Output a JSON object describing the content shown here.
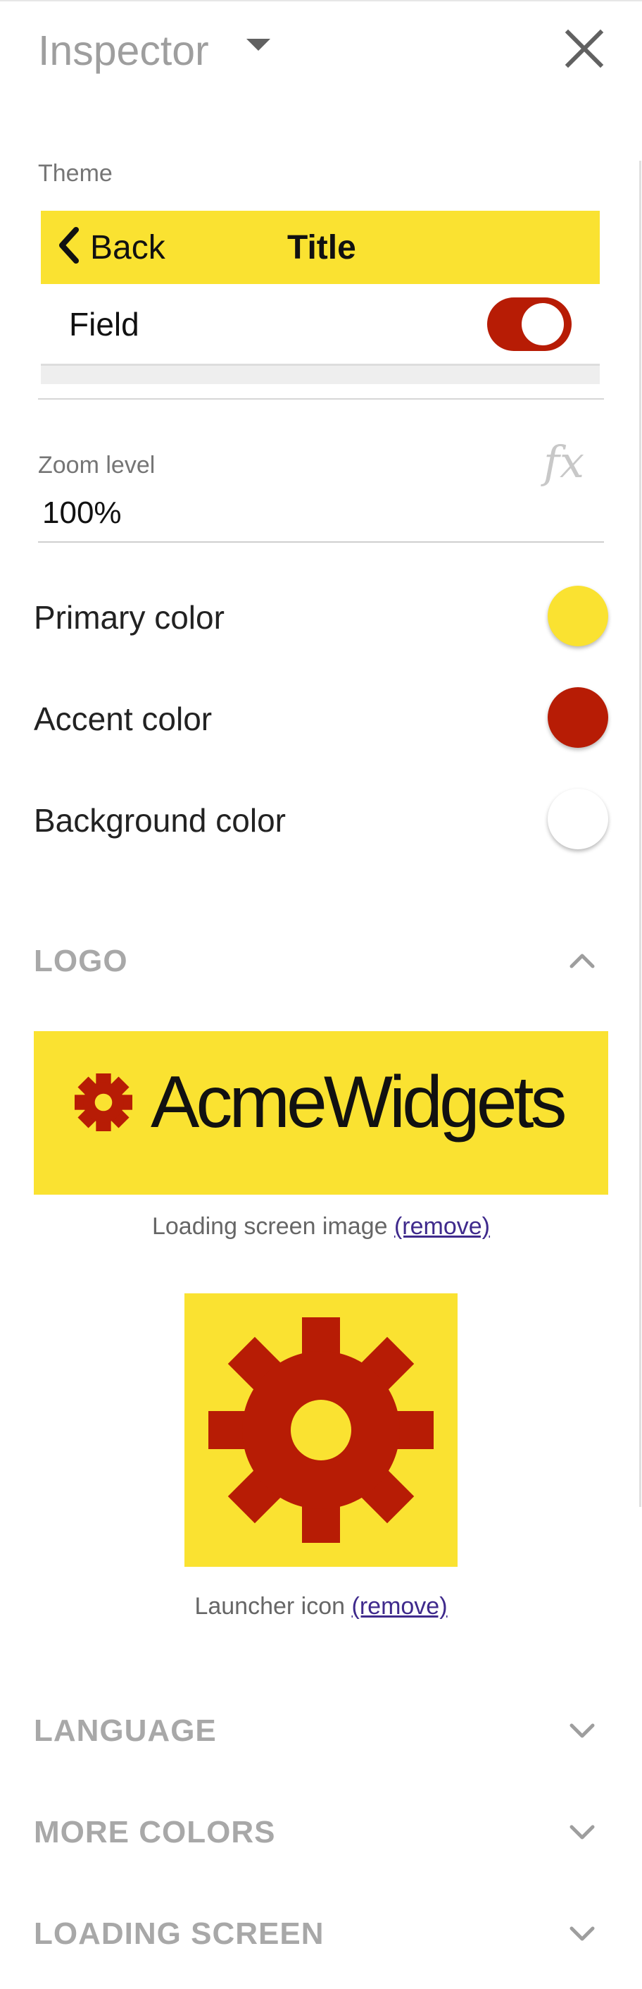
{
  "header": {
    "title": "Inspector"
  },
  "theme": {
    "label": "Theme",
    "preview": {
      "back_label": "Back",
      "title": "Title",
      "field_label": "Field",
      "toggle_on": true
    }
  },
  "zoom": {
    "label": "Zoom level",
    "value": "100%",
    "fx_label": "fx"
  },
  "colors": [
    {
      "label": "Primary color",
      "value": "#fae231"
    },
    {
      "label": "Accent color",
      "value": "#b71c05"
    },
    {
      "label": "Background color",
      "value": "#ffffff"
    }
  ],
  "logo": {
    "section_title": "LOGO",
    "expanded": true,
    "banner_text": "AcmeWidgets",
    "loading_caption": "Loading screen image",
    "launcher_caption": "Launcher icon",
    "remove_label": "(remove)"
  },
  "sections": [
    {
      "title": "LANGUAGE",
      "expanded": false
    },
    {
      "title": "MORE COLORS",
      "expanded": false
    },
    {
      "title": "LOADING SCREEN",
      "expanded": false
    }
  ],
  "icons": {
    "close": "close-icon",
    "dropdown": "dropdown-arrow-icon",
    "back": "chevron-left-icon",
    "collapse": "chevron-up-icon",
    "expand": "chevron-down-icon",
    "gear": "gear-icon"
  }
}
